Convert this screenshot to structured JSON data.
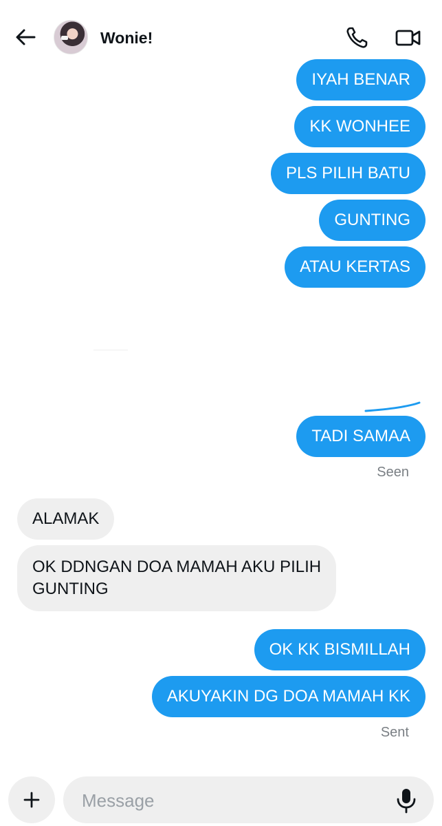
{
  "header": {
    "contact_name": "Wonie!",
    "back_icon": "arrow-left-icon",
    "call_icon": "phone-icon",
    "video_icon": "video-camera-icon"
  },
  "messages": [
    {
      "direction": "out",
      "text": "IYAH BENAR"
    },
    {
      "direction": "out",
      "text": "KK WONHEE"
    },
    {
      "direction": "out",
      "text": "PLS PILIH BATU"
    },
    {
      "direction": "out",
      "text": "GUNTING"
    },
    {
      "direction": "out",
      "text": "ATAU KERTAS"
    },
    {
      "direction": "out",
      "text": "TADI SAMAA"
    },
    {
      "direction": "in",
      "text": "ALAMAK"
    },
    {
      "direction": "in",
      "text": "OK DDNGAN DOA MAMAH AKU PILIH",
      "text_line2": "GUNTING"
    },
    {
      "direction": "out",
      "text": "OK KK BISMILLAH"
    },
    {
      "direction": "out",
      "text": "AKUYAKIN DG DOA MAMAH KK"
    }
  ],
  "status": {
    "seen": "Seen",
    "sent": "Sent"
  },
  "composer": {
    "placeholder": "Message",
    "plus_icon": "plus-icon",
    "mic_icon": "microphone-icon"
  },
  "colors": {
    "outgoing_bubble": "#1d9bf0",
    "incoming_bubble": "#efefef",
    "status_text": "#7a7f84"
  }
}
